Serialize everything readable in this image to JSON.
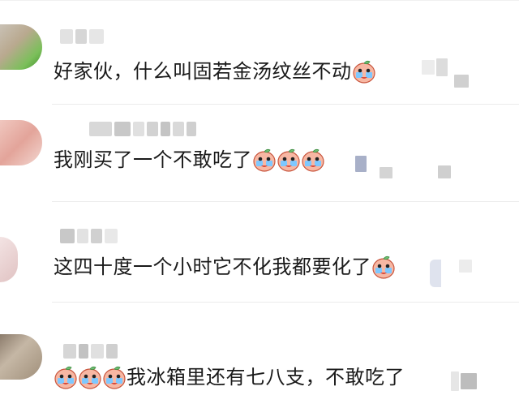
{
  "comments": [
    {
      "text": "好家伙，什么叫固若金汤纹丝不动",
      "emoji_after": 1,
      "emoji_before": 0
    },
    {
      "text": "我刚买了一个不敢吃了",
      "emoji_after": 3,
      "emoji_before": 0
    },
    {
      "text": "这四十度一个小时它不化我都要化了",
      "emoji_after": 1,
      "emoji_before": 0
    },
    {
      "text": "我冰箱里还有七八支，不敢吃了",
      "emoji_after": 0,
      "emoji_before": 3
    }
  ],
  "emoji_icon": "crying-peach-emoji-icon",
  "colors": {
    "text": "#1a1a1a",
    "divider": "#ececec",
    "blur_gray": "#d0d0d0"
  }
}
